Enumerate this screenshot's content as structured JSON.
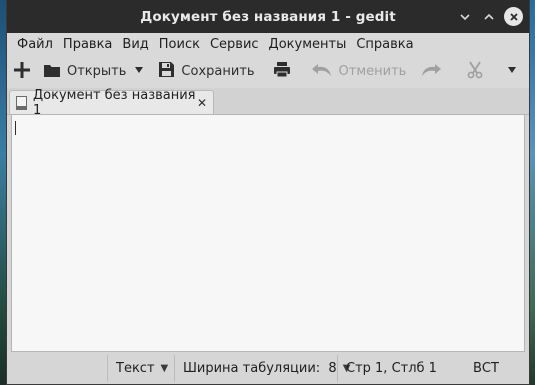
{
  "window": {
    "title": "Документ без названия 1 - gedit"
  },
  "menubar": {
    "items": [
      "Файл",
      "Правка",
      "Вид",
      "Поиск",
      "Сервис",
      "Документы",
      "Справка"
    ]
  },
  "toolbar": {
    "open_label": "Открыть",
    "save_label": "Сохранить",
    "undo_label": "Отменить"
  },
  "tab": {
    "label": "Документ без названия 1",
    "close_glyph": "✕"
  },
  "statusbar": {
    "language": "Текст",
    "tab_width": "Ширина табуляции:  8",
    "position": "Стр 1, Стлб 1",
    "insert_mode": "ВСТ"
  },
  "icons": {
    "new": "plus-icon",
    "open": "folder-icon",
    "save": "floppy-icon",
    "print": "printer-icon",
    "undo": "undo-icon",
    "redo": "redo-icon",
    "cut": "scissors-icon"
  }
}
